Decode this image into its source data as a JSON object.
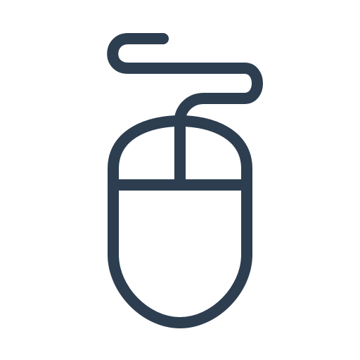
{
  "icon": {
    "name": "computer-mouse-icon",
    "stroke_color": "#2d3e50",
    "background_color": "#ffffff"
  }
}
